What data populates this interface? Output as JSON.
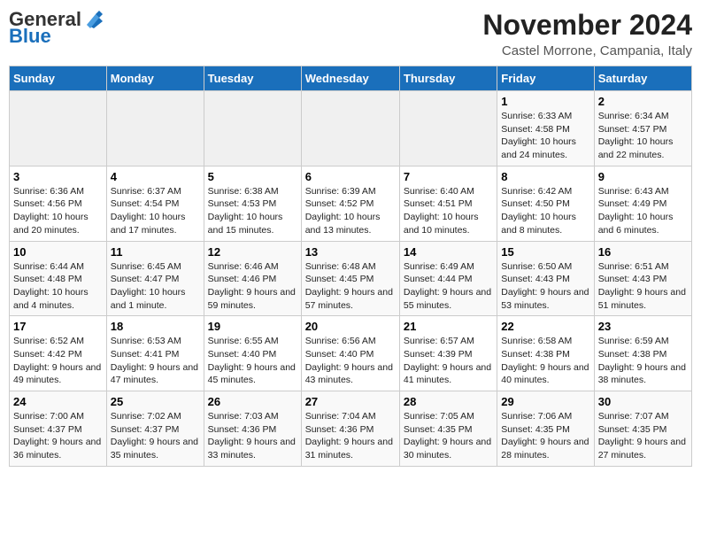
{
  "logo": {
    "general": "General",
    "blue": "Blue"
  },
  "title": "November 2024",
  "subtitle": "Castel Morrone, Campania, Italy",
  "days_of_week": [
    "Sunday",
    "Monday",
    "Tuesday",
    "Wednesday",
    "Thursday",
    "Friday",
    "Saturday"
  ],
  "weeks": [
    [
      {
        "day": "",
        "content": ""
      },
      {
        "day": "",
        "content": ""
      },
      {
        "day": "",
        "content": ""
      },
      {
        "day": "",
        "content": ""
      },
      {
        "day": "",
        "content": ""
      },
      {
        "day": "1",
        "content": "Sunrise: 6:33 AM\nSunset: 4:58 PM\nDaylight: 10 hours and 24 minutes."
      },
      {
        "day": "2",
        "content": "Sunrise: 6:34 AM\nSunset: 4:57 PM\nDaylight: 10 hours and 22 minutes."
      }
    ],
    [
      {
        "day": "3",
        "content": "Sunrise: 6:36 AM\nSunset: 4:56 PM\nDaylight: 10 hours and 20 minutes."
      },
      {
        "day": "4",
        "content": "Sunrise: 6:37 AM\nSunset: 4:54 PM\nDaylight: 10 hours and 17 minutes."
      },
      {
        "day": "5",
        "content": "Sunrise: 6:38 AM\nSunset: 4:53 PM\nDaylight: 10 hours and 15 minutes."
      },
      {
        "day": "6",
        "content": "Sunrise: 6:39 AM\nSunset: 4:52 PM\nDaylight: 10 hours and 13 minutes."
      },
      {
        "day": "7",
        "content": "Sunrise: 6:40 AM\nSunset: 4:51 PM\nDaylight: 10 hours and 10 minutes."
      },
      {
        "day": "8",
        "content": "Sunrise: 6:42 AM\nSunset: 4:50 PM\nDaylight: 10 hours and 8 minutes."
      },
      {
        "day": "9",
        "content": "Sunrise: 6:43 AM\nSunset: 4:49 PM\nDaylight: 10 hours and 6 minutes."
      }
    ],
    [
      {
        "day": "10",
        "content": "Sunrise: 6:44 AM\nSunset: 4:48 PM\nDaylight: 10 hours and 4 minutes."
      },
      {
        "day": "11",
        "content": "Sunrise: 6:45 AM\nSunset: 4:47 PM\nDaylight: 10 hours and 1 minute."
      },
      {
        "day": "12",
        "content": "Sunrise: 6:46 AM\nSunset: 4:46 PM\nDaylight: 9 hours and 59 minutes."
      },
      {
        "day": "13",
        "content": "Sunrise: 6:48 AM\nSunset: 4:45 PM\nDaylight: 9 hours and 57 minutes."
      },
      {
        "day": "14",
        "content": "Sunrise: 6:49 AM\nSunset: 4:44 PM\nDaylight: 9 hours and 55 minutes."
      },
      {
        "day": "15",
        "content": "Sunrise: 6:50 AM\nSunset: 4:43 PM\nDaylight: 9 hours and 53 minutes."
      },
      {
        "day": "16",
        "content": "Sunrise: 6:51 AM\nSunset: 4:43 PM\nDaylight: 9 hours and 51 minutes."
      }
    ],
    [
      {
        "day": "17",
        "content": "Sunrise: 6:52 AM\nSunset: 4:42 PM\nDaylight: 9 hours and 49 minutes."
      },
      {
        "day": "18",
        "content": "Sunrise: 6:53 AM\nSunset: 4:41 PM\nDaylight: 9 hours and 47 minutes."
      },
      {
        "day": "19",
        "content": "Sunrise: 6:55 AM\nSunset: 4:40 PM\nDaylight: 9 hours and 45 minutes."
      },
      {
        "day": "20",
        "content": "Sunrise: 6:56 AM\nSunset: 4:40 PM\nDaylight: 9 hours and 43 minutes."
      },
      {
        "day": "21",
        "content": "Sunrise: 6:57 AM\nSunset: 4:39 PM\nDaylight: 9 hours and 41 minutes."
      },
      {
        "day": "22",
        "content": "Sunrise: 6:58 AM\nSunset: 4:38 PM\nDaylight: 9 hours and 40 minutes."
      },
      {
        "day": "23",
        "content": "Sunrise: 6:59 AM\nSunset: 4:38 PM\nDaylight: 9 hours and 38 minutes."
      }
    ],
    [
      {
        "day": "24",
        "content": "Sunrise: 7:00 AM\nSunset: 4:37 PM\nDaylight: 9 hours and 36 minutes."
      },
      {
        "day": "25",
        "content": "Sunrise: 7:02 AM\nSunset: 4:37 PM\nDaylight: 9 hours and 35 minutes."
      },
      {
        "day": "26",
        "content": "Sunrise: 7:03 AM\nSunset: 4:36 PM\nDaylight: 9 hours and 33 minutes."
      },
      {
        "day": "27",
        "content": "Sunrise: 7:04 AM\nSunset: 4:36 PM\nDaylight: 9 hours and 31 minutes."
      },
      {
        "day": "28",
        "content": "Sunrise: 7:05 AM\nSunset: 4:35 PM\nDaylight: 9 hours and 30 minutes."
      },
      {
        "day": "29",
        "content": "Sunrise: 7:06 AM\nSunset: 4:35 PM\nDaylight: 9 hours and 28 minutes."
      },
      {
        "day": "30",
        "content": "Sunrise: 7:07 AM\nSunset: 4:35 PM\nDaylight: 9 hours and 27 minutes."
      }
    ]
  ]
}
